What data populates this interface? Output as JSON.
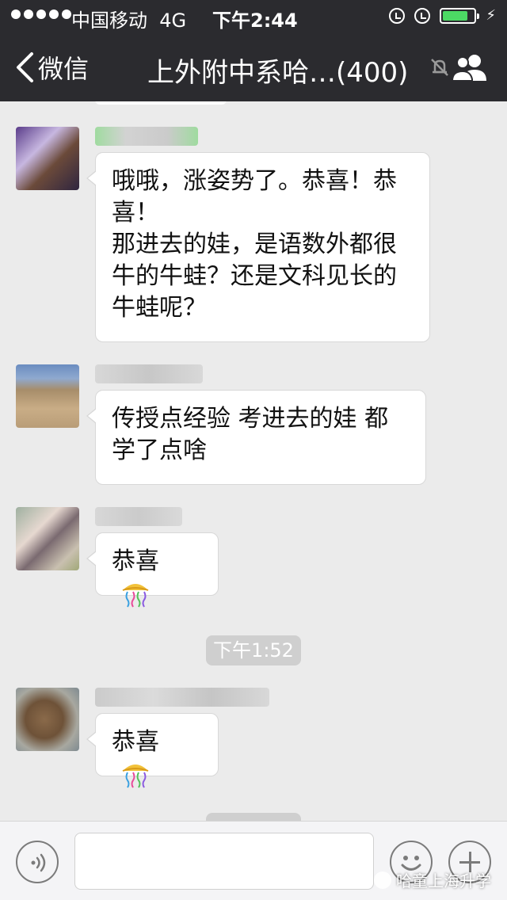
{
  "status_bar": {
    "carrier": "中国移动",
    "network": "4G",
    "time": "下午2:44"
  },
  "nav": {
    "back_label": "微信",
    "title": "上外附中系哈…(400)"
  },
  "messages": [
    {
      "text_lines": [
        "哦哦，涨姿势了。恭喜！恭",
        "喜！",
        "那进去的娃，是语数外都很",
        "牛的牛蛙？还是文科见长的",
        "牛蛙呢？"
      ]
    },
    {
      "text_lines": [
        "传授点经验  考进去的娃 都",
        "学了点啥"
      ]
    },
    {
      "text": "恭喜"
    },
    {
      "text": "恭喜"
    }
  ],
  "timestamp": "下午1:52",
  "watermark": "哈童上海升学",
  "colors": {
    "header_bg": "#2b2b2f",
    "chat_bg": "#ebebeb",
    "bubble_bg": "#ffffff",
    "battery_fill": "#4cd964"
  },
  "icons": {
    "back": "chevron-left-icon",
    "mute": "bell-muted-icon",
    "members": "group-members-icon",
    "voice": "voice-icon",
    "emoji": "smiley-icon",
    "plus": "plus-icon",
    "confetti": "party-popper-emoji"
  }
}
